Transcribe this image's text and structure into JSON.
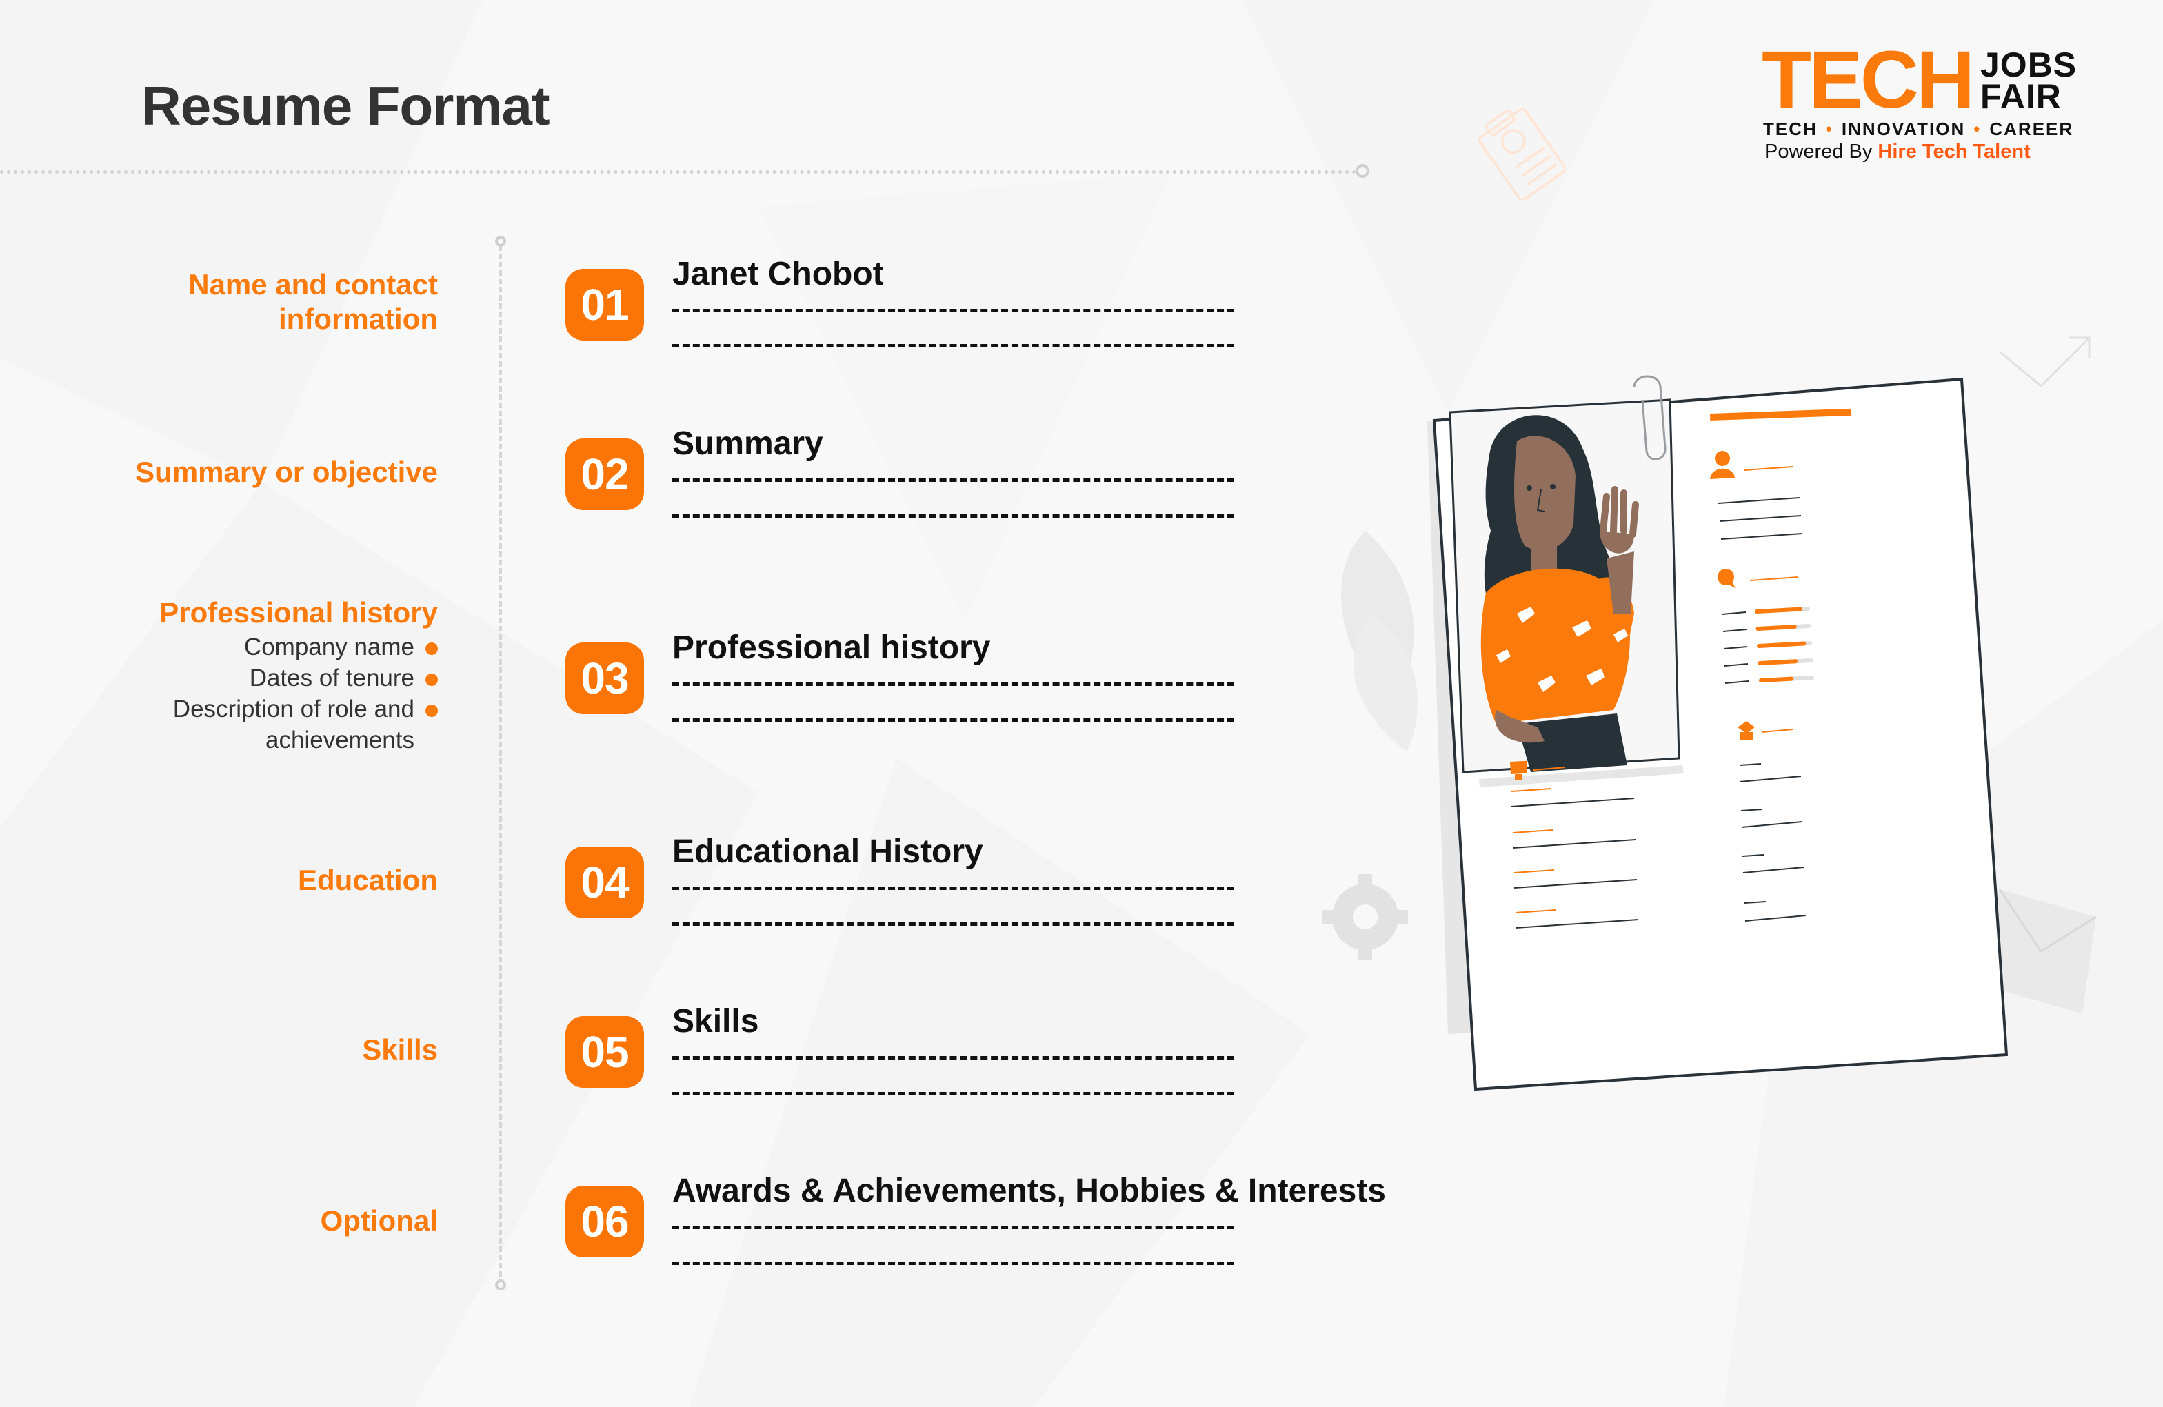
{
  "page": {
    "title": "Resume Format"
  },
  "logo": {
    "tech": "TECH",
    "jobs": "JOBS",
    "fair": "FAIR",
    "tagline": [
      "TECH",
      "INNOVATION",
      "CAREER"
    ],
    "powered_prefix": "Powered By",
    "powered_brand": "Hire Tech Talent"
  },
  "colors": {
    "accent": "#fb7a0c",
    "badge": "#fb7506",
    "brand_red": "#ff5a14",
    "title": "#333333",
    "background": "#f8f8f8"
  },
  "left_labels": [
    {
      "text_lines": [
        "Name and contact",
        "information"
      ]
    },
    {
      "text_lines": [
        "Summary or objective"
      ]
    },
    {
      "text_lines": [
        "Professional history"
      ],
      "sub_items": [
        {
          "lines": [
            "Company name"
          ]
        },
        {
          "lines": [
            "Dates of tenure"
          ]
        },
        {
          "lines": [
            "Description of role and",
            "achievements"
          ]
        }
      ]
    },
    {
      "text_lines": [
        "Education"
      ]
    },
    {
      "text_lines": [
        "Skills"
      ]
    },
    {
      "text_lines": [
        "Optional"
      ]
    }
  ],
  "sections": [
    {
      "number": "01",
      "title": "Janet Chobot"
    },
    {
      "number": "02",
      "title": "Summary"
    },
    {
      "number": "03",
      "title": "Professional history"
    },
    {
      "number": "04",
      "title": "Educational History"
    },
    {
      "number": "05",
      "title": "Skills"
    },
    {
      "number": "06",
      "title": "Awards & Achievements, Hobbies & Interests"
    }
  ],
  "illustration": {
    "subject": "woman-waving-resume-illustration",
    "skill_bars": [
      0.85,
      0.72,
      0.88,
      0.7,
      0.6
    ]
  }
}
